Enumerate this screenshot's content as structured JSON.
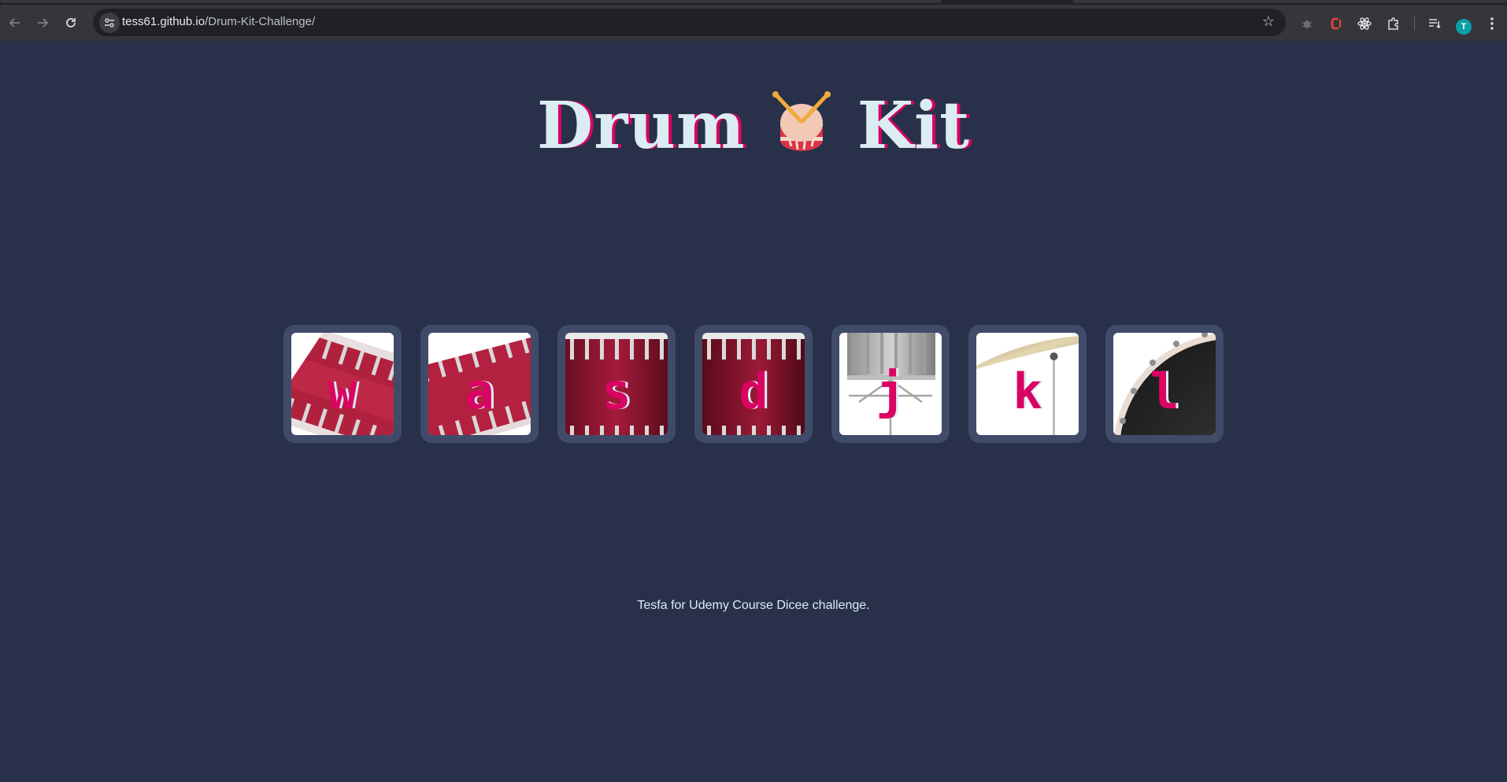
{
  "browser": {
    "url_host": "tess61.github.io",
    "url_path": "/Drum-Kit-Challenge/",
    "profile_initial": "T",
    "icons": [
      "back-icon",
      "forward-icon",
      "reload-icon",
      "site-info-icon",
      "bookmark-star-icon",
      "bug-icon",
      "extension-c-icon",
      "react-devtools-icon",
      "extensions-puzzle-icon",
      "reading-list-icon",
      "menu-kebab-icon"
    ]
  },
  "page": {
    "title_left": "Drum",
    "title_right": "Kit",
    "title_emoji": "drum-with-sticks-icon",
    "drums": [
      {
        "key": "w",
        "instrument": "tom-1"
      },
      {
        "key": "a",
        "instrument": "tom-2"
      },
      {
        "key": "s",
        "instrument": "tom-3"
      },
      {
        "key": "d",
        "instrument": "tom-4"
      },
      {
        "key": "j",
        "instrument": "snare"
      },
      {
        "key": "k",
        "instrument": "crash"
      },
      {
        "key": "l",
        "instrument": "kick-bass"
      }
    ],
    "footer": "Tesfa for Udemy Course Dicee challenge."
  },
  "colors": {
    "background": "#283149",
    "button_frame": "#404b69",
    "title_text": "#dbedf3",
    "accent_pink": "#da0463"
  }
}
